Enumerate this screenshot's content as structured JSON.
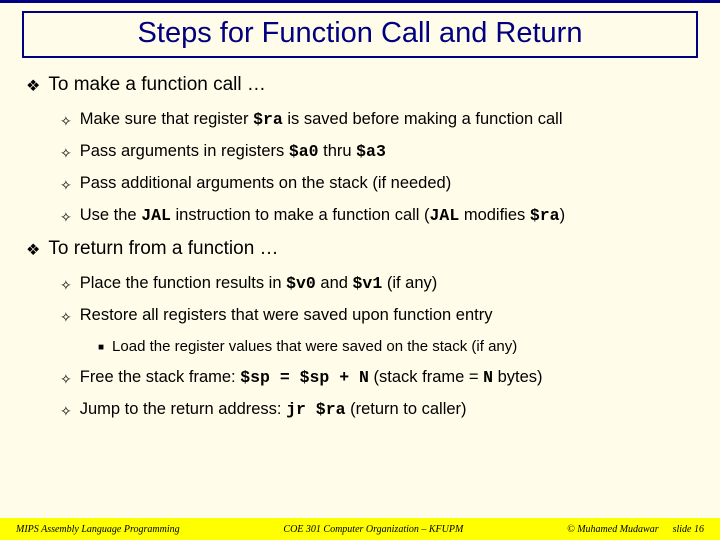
{
  "title": "Steps for Function Call and Return",
  "section1": {
    "heading": "To make a function call …",
    "items": [
      {
        "pre": "Make sure that register ",
        "code1": "$ra",
        "post": " is saved before making a function call"
      },
      {
        "pre": "Pass arguments in registers ",
        "code1": "$a0",
        "mid": " thru ",
        "code2": "$a3"
      },
      {
        "pre": "Pass additional arguments on the stack (if needed)"
      },
      {
        "pre": "Use the ",
        "code1": "JAL",
        "mid": " instruction to make a function call (",
        "code2": "JAL",
        "mid2": " modifies ",
        "code3": "$ra",
        "post": ")"
      }
    ]
  },
  "section2": {
    "heading": "To return from a function …",
    "items": [
      {
        "pre": "Place the function results in ",
        "code1": "$v0",
        "mid": " and ",
        "code2": "$v1",
        "post": " (if any)"
      },
      {
        "pre": "Restore all registers that were saved upon function entry"
      },
      {
        "sub": "Load the register values that were saved on the stack (if any)"
      },
      {
        "pre": "Free the stack frame: ",
        "code1": "$sp = $sp + N",
        "post": " (stack frame = ",
        "code2": "N",
        "post2": " bytes)"
      },
      {
        "pre": "Jump to the return address: ",
        "code1": "jr $ra",
        "post": " (return to caller)"
      }
    ]
  },
  "footer": {
    "left": "MIPS Assembly Language Programming",
    "center": "COE 301 Computer Organization – KFUPM",
    "author": "© Muhamed Mudawar",
    "slide": "slide 16"
  }
}
